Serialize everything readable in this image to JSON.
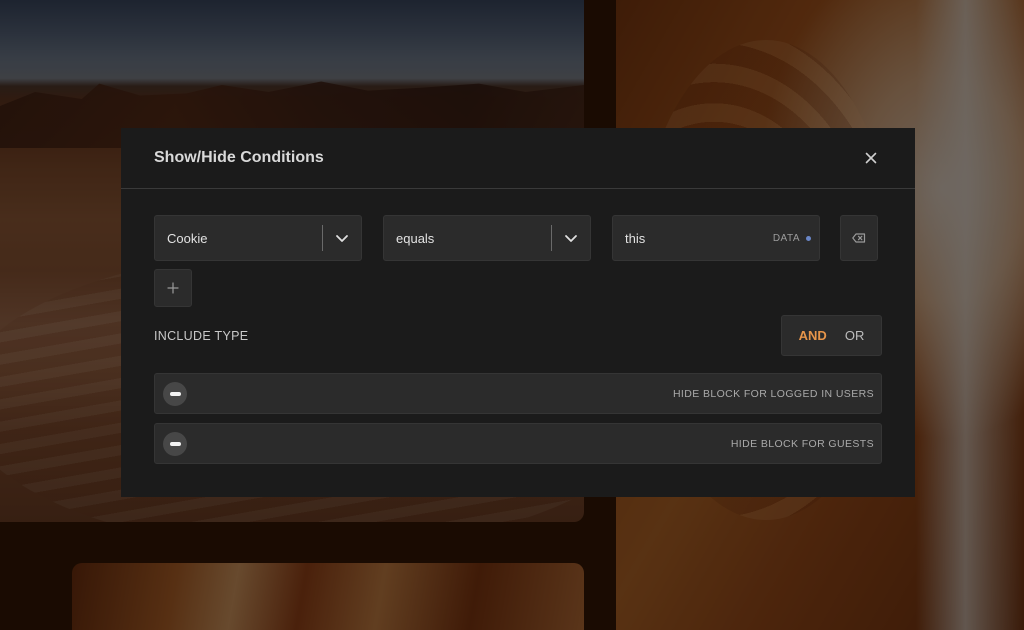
{
  "modal": {
    "title": "Show/Hide Conditions"
  },
  "condition": {
    "field": "Cookie",
    "operator": "equals",
    "value": "this",
    "value_tag": "DATA"
  },
  "include_type": {
    "label": "INCLUDE TYPE",
    "options": [
      "AND",
      "OR"
    ],
    "selected": "AND"
  },
  "toggles": [
    {
      "label": "HIDE BLOCK FOR LOGGED IN USERS",
      "enabled": false
    },
    {
      "label": "HIDE BLOCK FOR GUESTS",
      "enabled": false
    }
  ],
  "icons": {
    "close": "close-icon",
    "chevron": "chevron-down-icon",
    "clear": "backspace-icon",
    "add": "plus-icon"
  },
  "colors": {
    "accent": "#e6954a",
    "modal_bg": "#1b1b1b",
    "field_bg": "#2b2b2b",
    "data_dot": "#6a87c8"
  }
}
